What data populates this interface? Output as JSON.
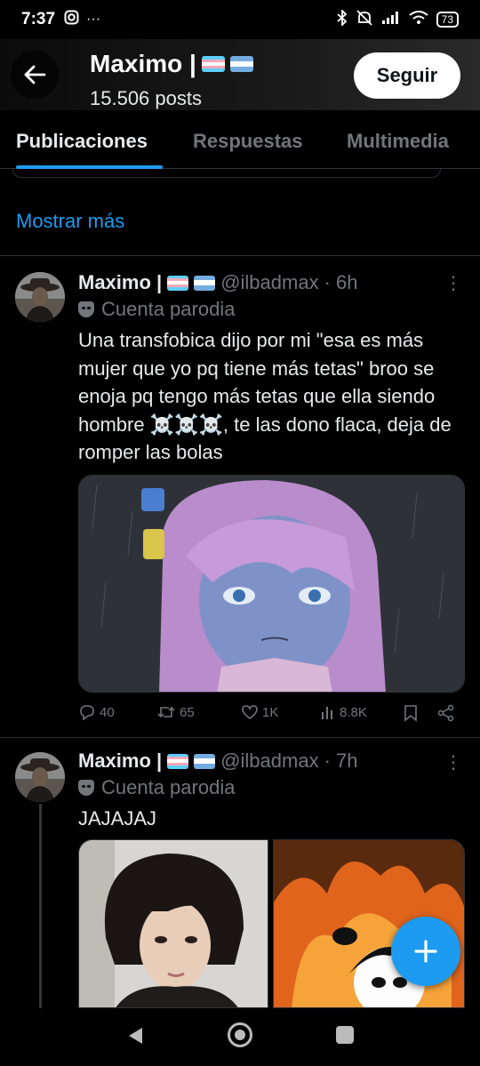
{
  "status_bar": {
    "time": "7:37",
    "battery": "73"
  },
  "header": {
    "name": "Maximo |",
    "posts": "15.506 posts",
    "follow_label": "Seguir"
  },
  "tabs": [
    {
      "label": "Publicaciones",
      "active": true
    },
    {
      "label": "Respuestas",
      "active": false
    },
    {
      "label": "Multimedia",
      "active": false
    }
  ],
  "show_more": "Mostrar más",
  "tweets": [
    {
      "name": "Maximo |",
      "handle": "@ilbadmax",
      "time": "· 6h",
      "parody_label": "Cuenta parodia",
      "text": "Una transfobica dijo por mi \"esa es más mujer que yo pq tiene más tetas\" broo se enoja pq tengo más tetas que ella siendo hombre ☠️☠️☠️, te las dono flaca, deja de romper las bolas",
      "stats": {
        "replies": "40",
        "retweets": "65",
        "likes": "1K",
        "views": "8.8K"
      }
    },
    {
      "name": "Maximo |",
      "handle": "@ilbadmax",
      "time": "· 7h",
      "parody_label": "Cuenta parodia",
      "text": "JAJAJAJ"
    }
  ],
  "colors": {
    "accent": "#1d9bf0",
    "background": "#000000",
    "secondary_text": "#71767b"
  }
}
